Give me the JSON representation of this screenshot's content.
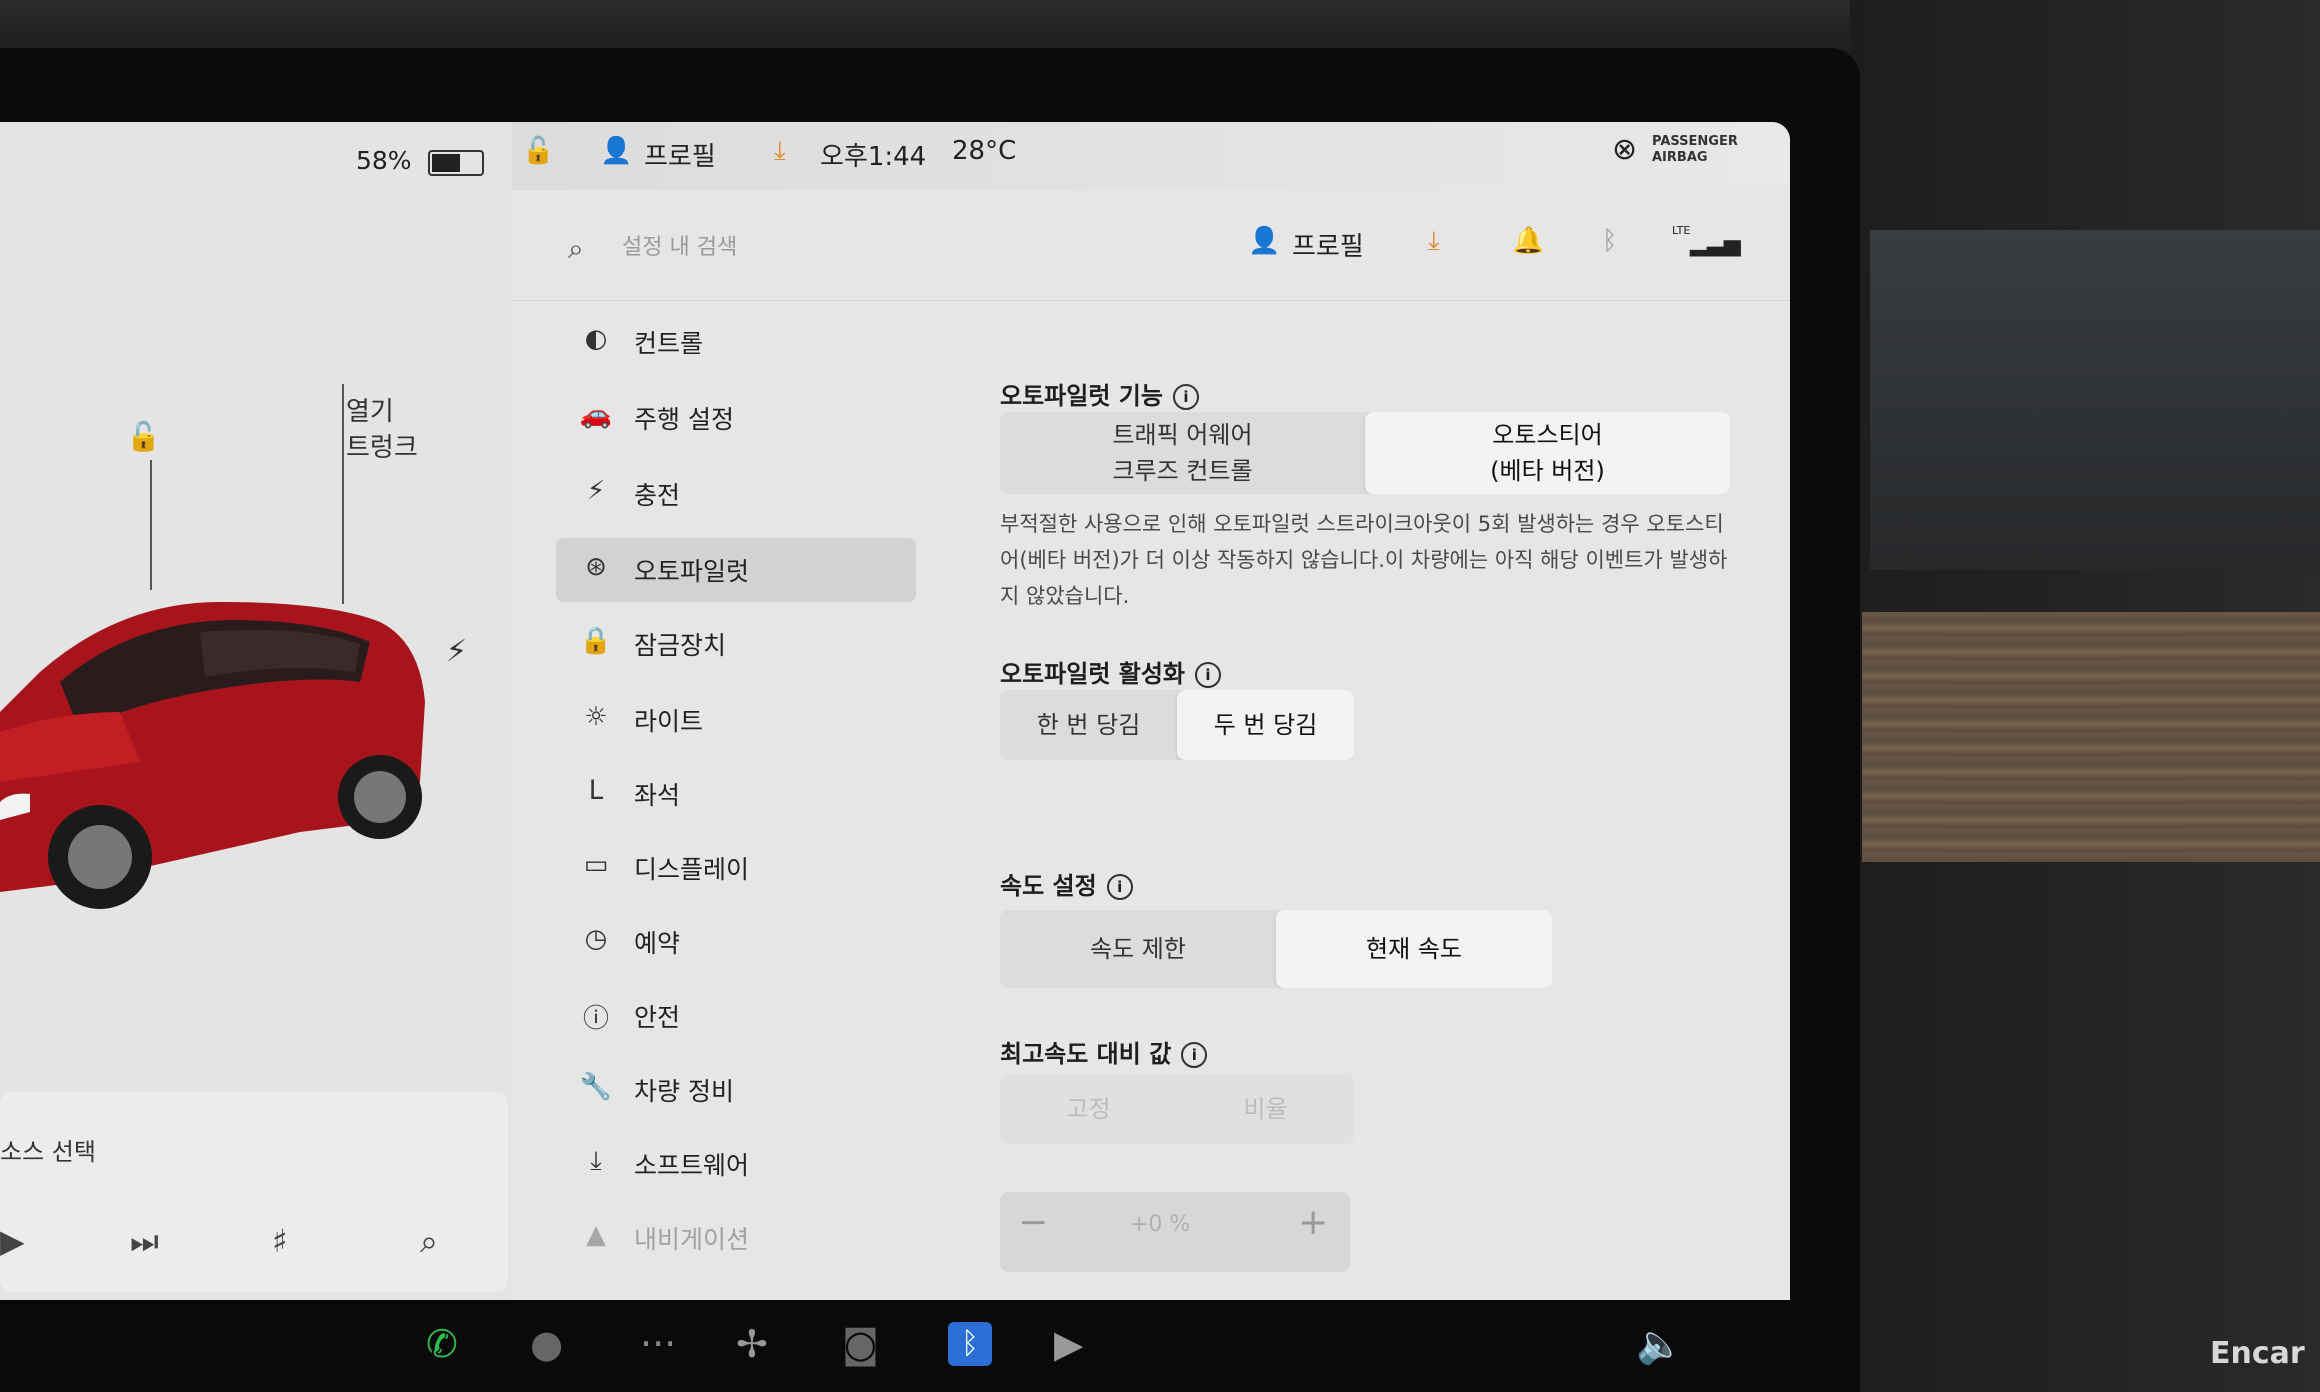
{
  "car": {
    "battery_percent": "58%",
    "battery_level": 0.58,
    "trunk_open_label": "열기",
    "trunk_label": "트렁크"
  },
  "status_bar": {
    "profile_label": "프로필",
    "time": "오후1:44",
    "temperature": "28°C",
    "airbag_line1": "PASSENGER",
    "airbag_line2": "AIRBAG"
  },
  "settings_header": {
    "search_placeholder": "설정 내 검색",
    "profile_label": "프로필",
    "signal_label": "LTE"
  },
  "menu": {
    "items": [
      {
        "label": "컨트롤",
        "icon": "toggle-icon"
      },
      {
        "label": "주행 설정",
        "icon": "car-icon"
      },
      {
        "label": "충전",
        "icon": "bolt-icon"
      },
      {
        "label": "오토파일럿",
        "icon": "steering-wheel-icon",
        "active": true
      },
      {
        "label": "잠금장치",
        "icon": "lock-icon"
      },
      {
        "label": "라이트",
        "icon": "light-icon"
      },
      {
        "label": "좌석",
        "icon": "seat-icon"
      },
      {
        "label": "디스플레이",
        "icon": "display-icon"
      },
      {
        "label": "예약",
        "icon": "clock-icon"
      },
      {
        "label": "안전",
        "icon": "safety-icon"
      },
      {
        "label": "차량 정비",
        "icon": "wrench-icon"
      },
      {
        "label": "소프트웨어",
        "icon": "download-icon"
      },
      {
        "label": "내비게이션",
        "icon": "navigation-icon"
      }
    ]
  },
  "autopilot": {
    "features_title": "오토파일럿 기능",
    "features_options": [
      {
        "line1": "트래픽 어웨어",
        "line2": "크루즈 컨트롤"
      },
      {
        "line1": "오토스티어",
        "line2": "(베타 버전)"
      }
    ],
    "features_selected": "오토스티어",
    "description": "부적절한 사용으로 인해 오토파일럿 스트라이크아웃이 5회 발생하는 경우 오토스티어(베타 버전)가 더 이상 작동하지 않습니다.이 차량에는 아직 해당 이벤트가 발생하지 않았습니다.",
    "activation_title": "오토파일럿 활성화",
    "activation_options": [
      "한 번 당김",
      "두 번 당김"
    ],
    "activation_selected": "두 번 당김",
    "speed_title": "속도 설정",
    "speed_options": [
      "속도 제한",
      "현재 속도"
    ],
    "speed_selected": "현재 속도",
    "offset_title": "최고속도 대비 값",
    "offset_options": [
      "고정",
      "비율"
    ],
    "offset_value": "+0 %",
    "minus": "−",
    "plus": "+"
  },
  "media": {
    "source_label": "소스 선택"
  },
  "watermark": "Encar",
  "colors": {
    "accent_orange": "#e08a2a",
    "bluetooth_blue": "#2a6fd6",
    "phone_green": "#2fbf4f",
    "car_red": "#b3161d"
  }
}
